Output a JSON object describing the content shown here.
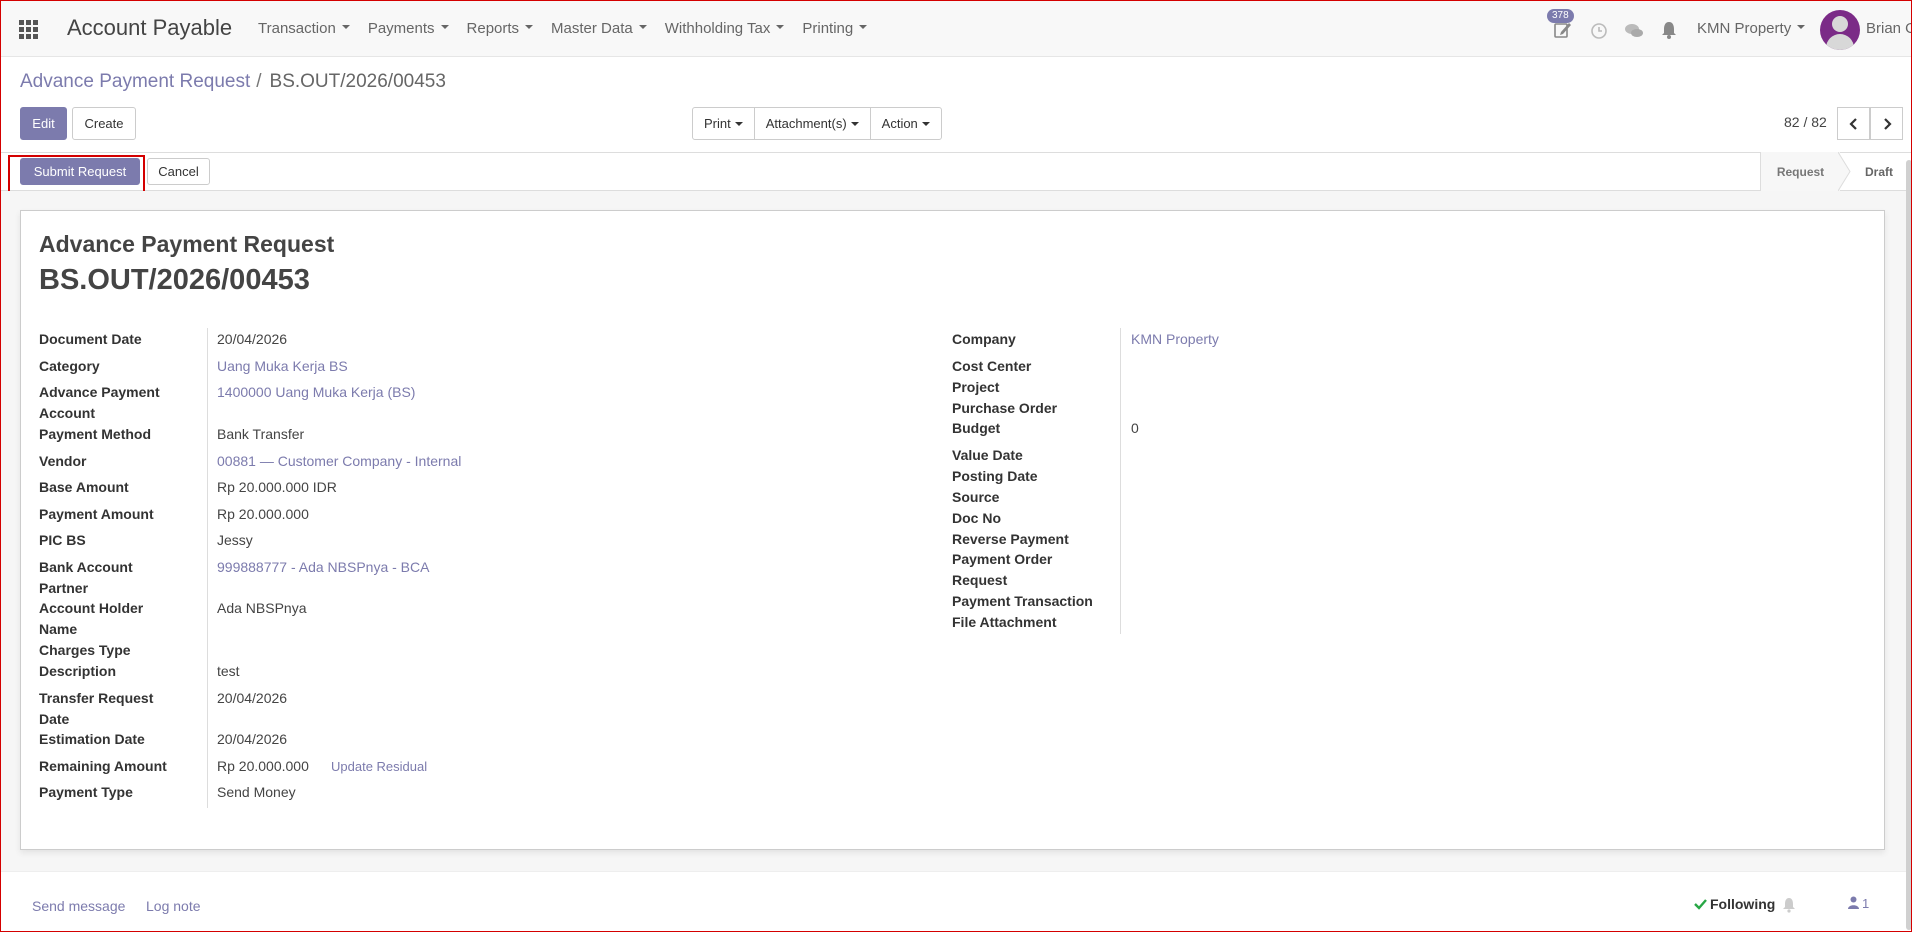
{
  "navbar": {
    "app_title": "Account Payable",
    "menu": [
      "Transaction",
      "Payments",
      "Reports",
      "Master Data",
      "Withholding Tax",
      "Printing"
    ],
    "activity_badge": "378",
    "company": "KMN Property",
    "user": "Brian O"
  },
  "breadcrumb": {
    "parent": "Advance Payment Request",
    "separator": "/",
    "current": "BS.OUT/2026/00453"
  },
  "toolbar": {
    "edit": "Edit",
    "create": "Create",
    "print": "Print",
    "attachments": "Attachment(s)",
    "action": "Action",
    "pager": "82 / 82"
  },
  "statusbar": {
    "submit": "Submit Request",
    "cancel": "Cancel",
    "stages": [
      "Request",
      "Draft"
    ],
    "active_stage": "Draft"
  },
  "sheet": {
    "doc_type": "Advance Payment Request",
    "doc_name": "BS.OUT/2026/00453",
    "left_fields": [
      {
        "label": "Document Date",
        "value": "20/04/2026",
        "link": false
      },
      {
        "label": "Category",
        "value": "Uang Muka Kerja BS",
        "link": true
      },
      {
        "label": "Advance Payment Account",
        "value": "1400000 Uang Muka Kerja (BS)",
        "link": true
      },
      {
        "label": "Payment Method",
        "value": "Bank Transfer",
        "link": false
      },
      {
        "label": "Vendor",
        "value": "00881 — Customer Company - Internal",
        "link": true
      },
      {
        "label": "Base Amount",
        "value": "Rp 20.000.000 IDR",
        "link": false
      },
      {
        "label": "Payment Amount",
        "value": "Rp 20.000.000",
        "link": false
      },
      {
        "label": "PIC BS",
        "value": "Jessy",
        "link": false
      },
      {
        "label": "Bank Account Partner",
        "value": "999888777 - Ada NBSPnya - BCA",
        "link": true
      },
      {
        "label": "Account Holder Name",
        "value": "Ada NBSPnya",
        "link": false
      },
      {
        "label": "Charges Type",
        "value": "",
        "link": false
      },
      {
        "label": "Description",
        "value": "test",
        "link": false
      },
      {
        "label": "Transfer Request Date",
        "value": "20/04/2026",
        "link": false
      },
      {
        "label": "Estimation Date",
        "value": "20/04/2026",
        "link": false
      },
      {
        "label": "Remaining Amount",
        "value": "Rp 20.000.000",
        "link": false
      },
      {
        "label": "Payment Type",
        "value": "Send Money",
        "link": false
      }
    ],
    "update_residual": "Update Residual",
    "right_fields": [
      {
        "label": "Company",
        "value": "KMN Property",
        "link": true
      },
      {
        "label": "Cost Center",
        "value": ""
      },
      {
        "label": "Project",
        "value": ""
      },
      {
        "label": "Purchase Order",
        "value": ""
      },
      {
        "label": "Budget",
        "value": "0"
      },
      {
        "label": "Value Date",
        "value": ""
      },
      {
        "label": "Posting Date",
        "value": ""
      },
      {
        "label": "Source",
        "value": ""
      },
      {
        "label": "Doc No",
        "value": ""
      },
      {
        "label": "Reverse Payment",
        "value": ""
      },
      {
        "label": "Payment Order Request",
        "value": ""
      },
      {
        "label": "Payment Transaction",
        "value": ""
      },
      {
        "label": "File Attachment",
        "value": ""
      }
    ]
  },
  "chatter": {
    "send_message": "Send message",
    "log_note": "Log note",
    "following": "Following",
    "followers_count": "1"
  },
  "colors": {
    "primary": "#7c7bad",
    "highlight": "#d40000"
  }
}
